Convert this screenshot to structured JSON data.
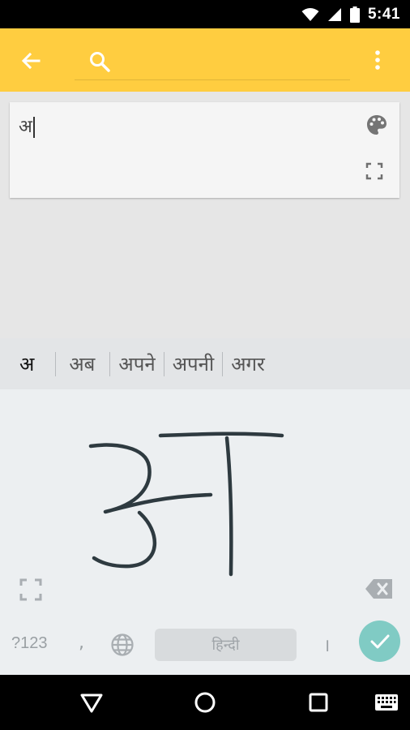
{
  "status_bar": {
    "time": "5:41",
    "icons": [
      "wifi-icon",
      "signal-icon",
      "battery-icon"
    ]
  },
  "app_bar": {
    "background": "#ffcd40",
    "icons": [
      "back-arrow-icon",
      "search-icon",
      "more-vert-icon"
    ]
  },
  "input": {
    "text": "अ",
    "icons": [
      "palette-icon",
      "expand-icon"
    ]
  },
  "suggestions": {
    "items": [
      "अ",
      "अब",
      "अपने",
      "अपनी",
      "अगर"
    ]
  },
  "keyboard": {
    "handwriting_char": "अ",
    "symbols_label": "?123",
    "comma_label": ",",
    "space_label": "हिन्दी",
    "danda_label": "।",
    "done_color": "#80cbc4",
    "icons": [
      "expand-icon",
      "backspace-icon",
      "globe-icon",
      "check-icon"
    ]
  },
  "nav_bar": {
    "icons": [
      "back-triangle-icon",
      "home-circle-icon",
      "recents-square-icon",
      "keyboard-icon"
    ]
  }
}
